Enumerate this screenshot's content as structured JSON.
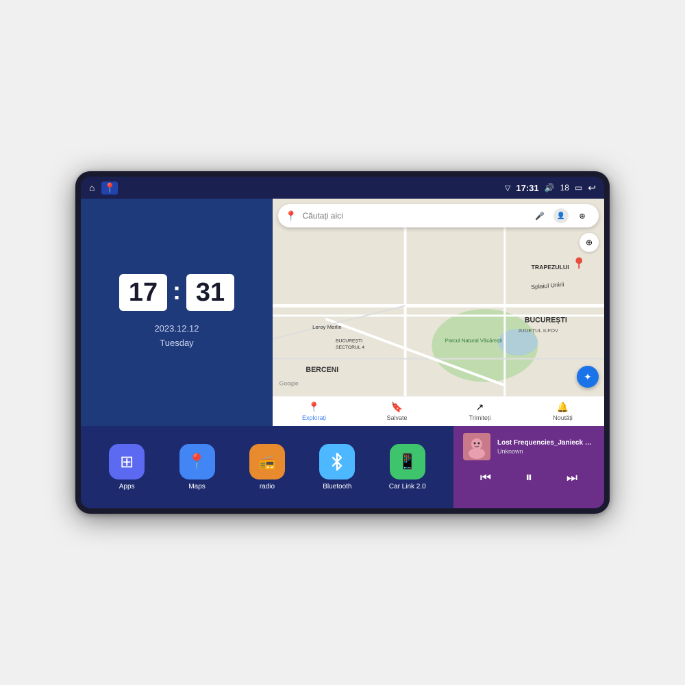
{
  "device": {
    "screen_bg": "#1e2a5e"
  },
  "status_bar": {
    "signal_icon": "▽",
    "time": "17:31",
    "volume_icon": "🔊",
    "battery_level": "18",
    "battery_icon": "▭",
    "back_icon": "↩"
  },
  "clock": {
    "hour": "17",
    "minute": "31",
    "date": "2023.12.12",
    "day": "Tuesday"
  },
  "map": {
    "search_placeholder": "Căutați aici",
    "nav_items": [
      {
        "label": "Explorați",
        "active": true
      },
      {
        "label": "Salvate",
        "active": false
      },
      {
        "label": "Trimiteți",
        "active": false
      },
      {
        "label": "Noutăți",
        "active": false
      }
    ],
    "location_names": [
      "TRAPEZULUI",
      "BUCUREȘTI",
      "JUDEȚUL ILFOV",
      "BERCENI",
      "Parcul Natural Văcărești",
      "Leroy Merlin",
      "BUCUREȘTI\nSECTORUL 4"
    ]
  },
  "apps": [
    {
      "id": "apps",
      "label": "Apps",
      "icon": "⊞",
      "color_class": "icon-apps"
    },
    {
      "id": "maps",
      "label": "Maps",
      "icon": "📍",
      "color_class": "icon-maps"
    },
    {
      "id": "radio",
      "label": "radio",
      "icon": "📻",
      "color_class": "icon-radio"
    },
    {
      "id": "bluetooth",
      "label": "Bluetooth",
      "icon": "⬡",
      "color_class": "icon-bluetooth"
    },
    {
      "id": "carlink",
      "label": "Car Link 2.0",
      "icon": "📱",
      "color_class": "icon-carlink"
    }
  ],
  "music": {
    "title": "Lost Frequencies_Janieck Devy-...",
    "artist": "Unknown",
    "prev_icon": "⏮",
    "play_icon": "⏸",
    "next_icon": "⏭"
  }
}
